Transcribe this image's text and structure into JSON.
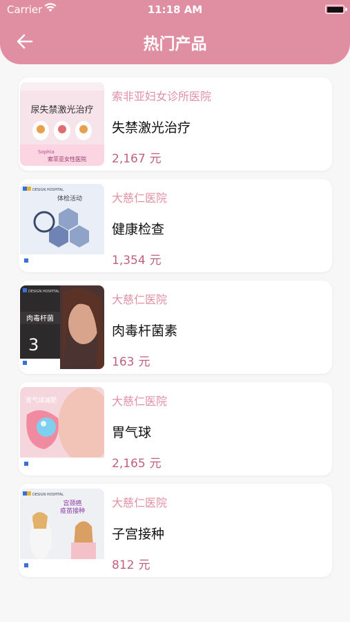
{
  "status": {
    "carrier": "Carrier",
    "time": "11:18 AM"
  },
  "header": {
    "title": "热门产品"
  },
  "currency_unit": "元",
  "products": [
    {
      "hospital": "索非亚妇女诊所医院",
      "name": "失禁激光治疗",
      "price": "2,167",
      "thumb_text": "尿失禁激光治疗",
      "thumb_sub": "索菲亚女性医院",
      "thumb_logo": "Sophia"
    },
    {
      "hospital": "大慈仁医院",
      "name": "健康检查",
      "price": "1,354",
      "thumb_text": "体检活动",
      "thumb_logo": "DESIGN HOSPITAL"
    },
    {
      "hospital": "大慈仁医院",
      "name": "肉毒杆菌素",
      "price": "163",
      "thumb_text": "肉毒杆菌",
      "thumb_num": "3",
      "thumb_logo": "DESIGN HOSPITAL"
    },
    {
      "hospital": "大慈仁医院",
      "name": "胃气球",
      "price": "2,165",
      "thumb_text": "胃气球减肥"
    },
    {
      "hospital": "大慈仁医院",
      "name": "子宫接种",
      "price": "812",
      "thumb_text": "宫颈癌",
      "thumb_sub": "疫苗接种",
      "thumb_logo": "DESIGN HOSPITAL"
    }
  ],
  "colors": {
    "header": "#e08fa3",
    "accent": "#e08fa3",
    "price": "#c0607e"
  }
}
